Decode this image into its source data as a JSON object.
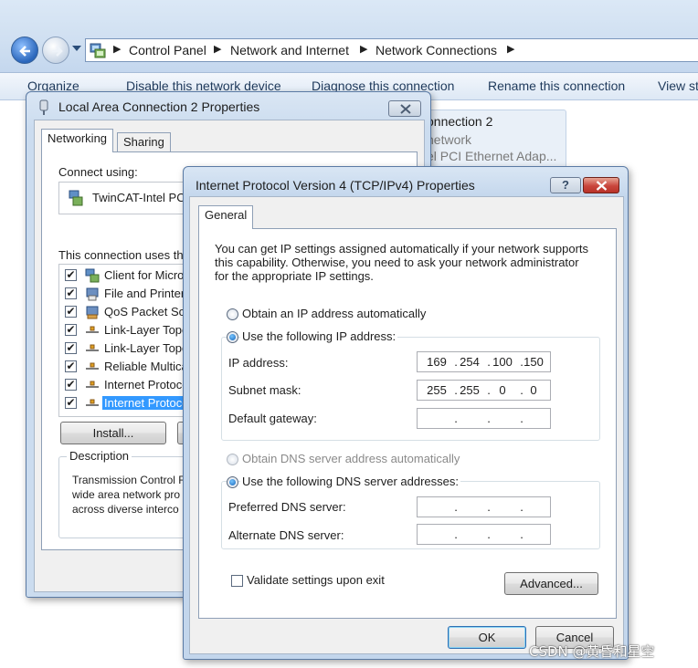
{
  "explorer": {
    "breadcrumbs": [
      "Control Panel",
      "Network and Internet",
      "Network Connections"
    ],
    "commands": [
      "Organize",
      "Disable this network device",
      "Diagnose this connection",
      "Rename this connection",
      "View st"
    ],
    "connection_tile": {
      "name": "onnection 2",
      "line2": "network",
      "line3": "el PCI Ethernet Adap..."
    }
  },
  "lan_dialog": {
    "title": "Local Area Connection 2 Properties",
    "tabs": [
      "Networking",
      "Sharing"
    ],
    "connect_using_label": "Connect using:",
    "adapter_name": "TwinCAT-Intel PCI",
    "uses_label": "This connection uses the",
    "items": [
      {
        "label": "Client for Micros",
        "checked": true,
        "icon": "network-client-icon"
      },
      {
        "label": "File and Printer",
        "checked": true,
        "icon": "file-printer-sharing-icon"
      },
      {
        "label": "QoS Packet Sc",
        "checked": true,
        "icon": "qos-scheduler-icon"
      },
      {
        "label": "Link-Layer Topo",
        "checked": true,
        "icon": "protocol-icon"
      },
      {
        "label": "Link-Layer Topo",
        "checked": true,
        "icon": "protocol-icon"
      },
      {
        "label": "Reliable Multica",
        "checked": true,
        "icon": "protocol-icon"
      },
      {
        "label": "Internet Protoco",
        "checked": true,
        "icon": "protocol-icon"
      },
      {
        "label": "Internet Protoco",
        "checked": true,
        "icon": "protocol-icon",
        "selected": true
      }
    ],
    "install_label": "Install...",
    "description_label": "Description",
    "description_lines": [
      "Transmission Control F",
      "wide area network pro",
      "across diverse interco"
    ]
  },
  "ipv4_dialog": {
    "title": "Internet Protocol Version 4 (TCP/IPv4) Properties",
    "help_glyph": "?",
    "tab": "General",
    "intro_lines": [
      "You can get IP settings assigned automatically if your network supports",
      "this capability. Otherwise, you need to ask your network administrator",
      "for the appropriate IP settings."
    ],
    "obtain_ip_auto": "Obtain an IP address automatically",
    "use_following_ip": "Use the following IP address:",
    "ip_label": "IP address:",
    "subnet_label": "Subnet mask:",
    "gateway_label": "Default gateway:",
    "ip_address": [
      "169",
      "254",
      "100",
      "150"
    ],
    "subnet_mask": [
      "255",
      "255",
      "0",
      "0"
    ],
    "default_gateway": [
      "",
      "",
      "",
      ""
    ],
    "obtain_dns_auto": "Obtain DNS server address automatically",
    "use_following_dns": "Use the following DNS server addresses:",
    "preferred_dns_label": "Preferred DNS server:",
    "alternate_dns_label": "Alternate DNS server:",
    "preferred_dns": [
      "",
      "",
      "",
      ""
    ],
    "alternate_dns": [
      "",
      "",
      "",
      ""
    ],
    "validate_label": "Validate settings upon exit",
    "advanced_label": "Advanced...",
    "ok_label": "OK",
    "cancel_label": "Cancel"
  },
  "watermark": "CSDN @黄昏和星空",
  "colors": {
    "accent_blue": "#3399ff",
    "selection": "#3399ff",
    "close_red": "#c9463d"
  }
}
